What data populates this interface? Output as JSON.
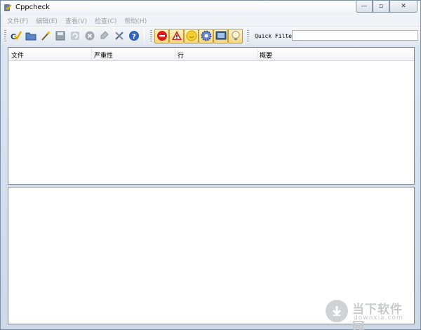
{
  "window": {
    "title": "Cppcheck",
    "controls": {
      "minimize": "—",
      "maximize": "▫",
      "close": "✕"
    }
  },
  "menu": [
    {
      "label": "文件(F)"
    },
    {
      "label": "编辑(E)"
    },
    {
      "label": "查看(V)"
    },
    {
      "label": "检查(C)"
    },
    {
      "label": "帮助(H)"
    }
  ],
  "toolbar": {
    "buttons": [
      "check-icon",
      "open-folder-icon",
      "wand-icon",
      "save-icon",
      "recheck-icon",
      "stop-icon",
      "clear-icon",
      "settings-icon",
      "help-icon"
    ],
    "filters": [
      "error-icon",
      "warning-icon",
      "style-icon",
      "performance-icon",
      "portability-icon",
      "information-icon"
    ],
    "quick_filter_label": "Quick Filter:"
  },
  "results_table": {
    "columns": [
      "文件",
      "严重性",
      "行",
      "概要"
    ],
    "rows": []
  },
  "watermark": {
    "name": "当下软件园",
    "url": "downxia.com"
  }
}
